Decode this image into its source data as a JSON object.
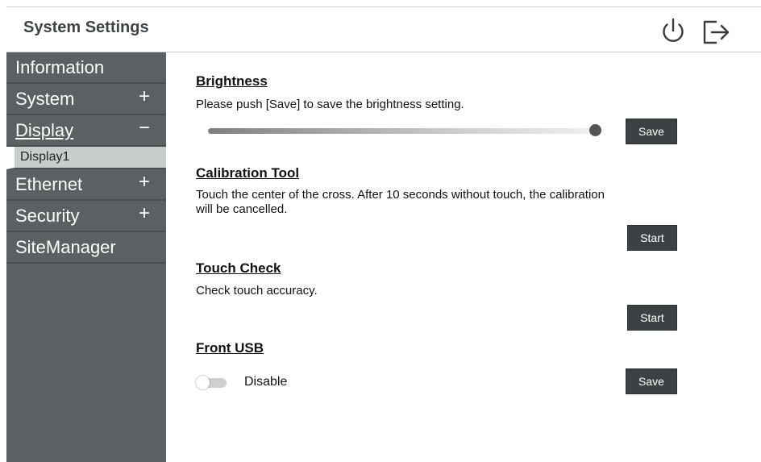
{
  "header": {
    "title": "System Settings",
    "power_icon": "power-icon",
    "logout_icon": "logout-icon"
  },
  "sidebar": {
    "items": [
      {
        "label": "Information",
        "sign": ""
      },
      {
        "label": "System",
        "sign": "+"
      },
      {
        "label": "Display",
        "sign": "−",
        "active": true
      },
      {
        "label": "Display1",
        "sub": true
      },
      {
        "label": "Ethernet",
        "sign": "+"
      },
      {
        "label": "Security",
        "sign": "+"
      },
      {
        "label": "SiteManager",
        "sign": ""
      }
    ]
  },
  "main": {
    "brightness": {
      "title": "Brightness",
      "description": "Please push [Save] to save the brightness setting.",
      "level": 0.98,
      "save_label": "Save"
    },
    "calibration": {
      "title": "Calibration Tool",
      "description_line1": "Touch the center of the cross. After 10 seconds without touch, the calibration",
      "description_line2": "will be cancelled.",
      "start_label": "Start"
    },
    "touch_check": {
      "title": "Touch Check",
      "description": "Check touch accuracy.",
      "start_label": "Start"
    },
    "front_usb": {
      "title": "Front USB",
      "toggle_state": "Disable",
      "enabled": false,
      "save_label": "Save"
    }
  },
  "colors": {
    "sidebar_bg": "#5b6162",
    "button_bg": "#3c4244",
    "title_text": "#3e4446"
  }
}
